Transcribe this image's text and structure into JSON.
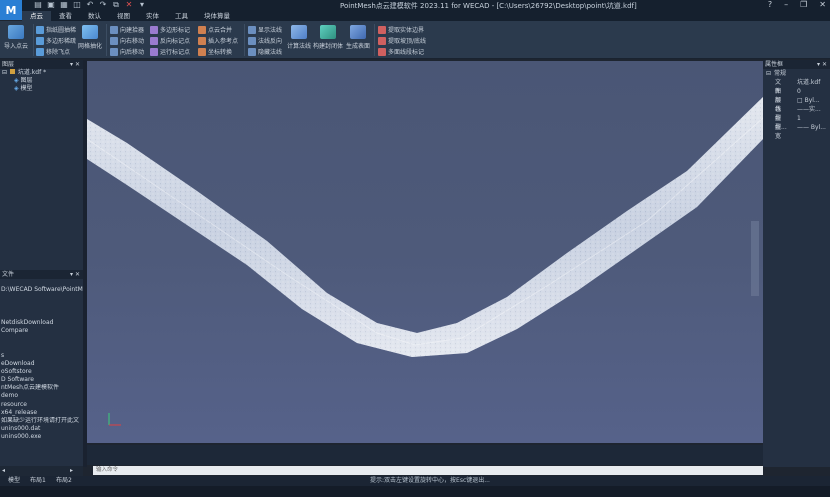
{
  "app": {
    "logo_letter": "M",
    "title": "PointMesh点云建模软件 2023.11 for WECAD - [C:\\Users\\26792\\Desktop\\point\\坑道.kdf]",
    "window_controls": [
      "?",
      "–",
      "❐",
      "✕"
    ]
  },
  "quick_access": [
    "▤",
    "▣",
    "▦",
    "◫",
    "↶",
    "↷",
    "⧉",
    "✕",
    "▾"
  ],
  "menu": {
    "tabs": [
      "点云",
      "查看",
      "数认",
      "视图",
      "实体",
      "工具",
      "块体算量"
    ],
    "active": 0
  },
  "ribbon": {
    "import_label": "导入点云",
    "group1": [
      "指纸圆抽稀",
      "多边形稀疏",
      "移除飞点"
    ],
    "grid_label": "网格抽化",
    "group2": [
      "向建拾器",
      "向右移动",
      "向后移动"
    ],
    "group3": [
      "多边形标记",
      "反向标记点",
      "运行标记点"
    ],
    "group4": [
      "点云合并",
      "插入参考点",
      "坐标转换"
    ],
    "group5": [
      "显示法线",
      "法线反向",
      "隐藏法线"
    ],
    "calc_label": "计算法线",
    "build_label": "构建封闭体",
    "surface_label": "生成表面",
    "group6": [
      "提取实体边界",
      "提取坡顶/底线",
      "多面线段标记"
    ]
  },
  "layers_panel": {
    "title": "图层",
    "root": "坑道.kdf *",
    "children": [
      "图层",
      "模型"
    ]
  },
  "files_panel": {
    "title": "文件",
    "items": [
      "D:\\WECAD Software\\PointMesh",
      "",
      "",
      "",
      "NetdiskDownload",
      "Compare",
      "",
      "",
      "s",
      "eDownload",
      "oSoftstore",
      "D Software",
      "ntMesh点云建模软件",
      "demo",
      "resource",
      "x64_release",
      "如果缺少运行环境请打开此文",
      "unins000.dat",
      "unins000.exe"
    ]
  },
  "properties_panel": {
    "title": "属性框",
    "section": "常规",
    "rows": [
      {
        "k": "文件",
        "v": "坑道.kdf"
      },
      {
        "k": "图层",
        "v": "0"
      },
      {
        "k": "颜色",
        "v": "□ Byl..."
      },
      {
        "k": "线型",
        "v": "——实..."
      },
      {
        "k": "线型...",
        "v": "1"
      },
      {
        "k": "线宽",
        "v": "—— Byl..."
      }
    ]
  },
  "command_placeholder": "输入命令",
  "layout_tabs": [
    "模型",
    "布局1",
    "布局2"
  ],
  "status_text": "提示:双击左键设置旋转中心，按Esc键退出...",
  "chart_data": null,
  "colors": {
    "accent": "#2a7fd4",
    "viewport_bg": "#4e5a7a",
    "panel_bg": "#243042",
    "ribbon_bg": "#2b3a4d"
  }
}
